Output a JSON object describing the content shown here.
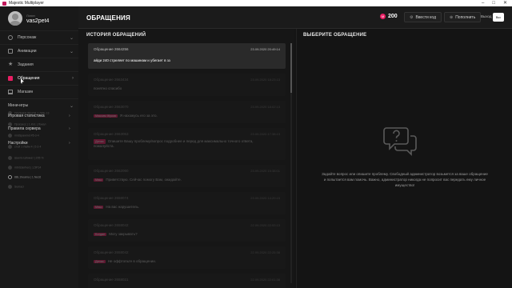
{
  "window": {
    "title": "Majestic Multiplayer",
    "controls": [
      "–",
      "□",
      "✕"
    ]
  },
  "profile": {
    "pre_label": "Логин",
    "username": "vas2pet4"
  },
  "sidebar": {
    "items": [
      {
        "label": "Персонаж",
        "icon": "user-icon"
      },
      {
        "label": "Анимации",
        "icon": "animation-icon"
      },
      {
        "label": "Задания",
        "icon": "star-icon"
      },
      {
        "label": "Обращения",
        "icon": "appeal-icon"
      },
      {
        "label": "Магазин",
        "icon": "shop-icon"
      },
      {
        "label": "Мини-игры",
        "icon": ""
      }
    ],
    "overlay_items": [
      "Игровая статистика",
      "Правила сервера",
      "Настройки"
    ],
    "ghost_rows": [
      "ПОЛНАЯ ЛЕНТА 1 ЛОБ 13",
      "Прогресс | 1.Ко1 | Локал",
      "mrdSpawmd #5-3-4",
      "стой 1 Лайм 4 | 5 3 4",
      "Шахта Шпинат | 205 %",
      "mbrS3erhed | 1.5Р14",
      "8BL1hearna | 1.Na16",
      "Sumaci"
    ],
    "chevron": "›"
  },
  "header": {
    "title": "ОБРАЩЕНИЯ",
    "balance": "200",
    "coin_symbol": "M",
    "redeem_label": "Ввести код",
    "topup_label": "Пополнить",
    "redeem_glyph": "⚙",
    "topup_glyph": "⊕",
    "logout_label": "Выход",
    "toggle_label": "Вкс"
  },
  "history": {
    "title": "ИСТОРИЯ ОБРАЩЕНИЙ",
    "tickets": [
      {
        "ticket": "Обращение 2664256",
        "date": "23.09.2020 20:49:14",
        "tag": "",
        "message": "айди 240 стреляет по машинам и убегает в зз"
      },
      {
        "ticket": "Обращение 2663434",
        "date": "23.09.2020 18:23:13",
        "tag": "",
        "message": "понятно спасибо"
      },
      {
        "ticket": "Обращение 2663070",
        "date": "23.09.2020 18:02:13",
        "tag": "Максим Жуков",
        "message": "Я нахожусь его за это."
      },
      {
        "ticket": "Обращение 2663063",
        "date": "23.09.2020 17:38:13",
        "tag": "Денис",
        "message": "Опишите Вашу проблему/вопрос подробнее и перед для максимально точного ответа, пожалуйста."
      },
      {
        "ticket": "Обращение 2662060",
        "date": "23.09.2020 15:38:01",
        "tag": "Маш",
        "message": "Приветствую. Сейчас помогу Вам, ожидайте."
      },
      {
        "ticket": "Обращение 2658074",
        "date": "23.09.2020 14:20:15",
        "tag": "Маш",
        "message": "На вас нарушитель."
      },
      {
        "ticket": "Обращение 2658042",
        "date": "22.09.2020 22:53:13",
        "tag": "Богдан",
        "message": "Могу закрывать?"
      },
      {
        "ticket": "Обращение 2658042",
        "date": "22.09.2020 22:25:38",
        "tag": "Денис",
        "message": "Не оффтопьте в обращении."
      },
      {
        "ticket": "Обращение 2658021",
        "date": "22.09.2020 22:01:38",
        "tag": "",
        "message": ""
      }
    ]
  },
  "picker": {
    "title": "ВЫБЕРИТЕ ОБРАЩЕНИЕ",
    "hint": "Задайте вопрос или опишите проблему. Свободный администратор возьмется за ваше обращение и попытается вам помочь. Важно, администратор никогда не попросит вас передать ему личное имущество!"
  },
  "colors": {
    "accent": "#e91e63",
    "background": "#141414",
    "panel": "#1e1e1e"
  }
}
